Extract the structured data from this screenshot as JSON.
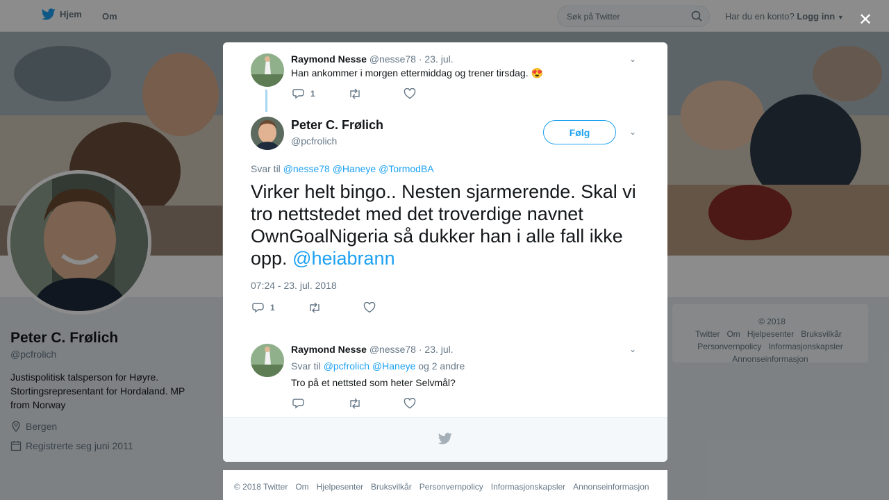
{
  "nav": {
    "home_label": "Hjem",
    "about_label": "Om",
    "search_placeholder": "Søk på Twitter",
    "account_question": "Har du en konto?",
    "login_label": "Logg inn"
  },
  "profile": {
    "name": "Peter C. Frølich",
    "handle": "@pcfrolich",
    "bio": "Justispolitisk talsperson for Høyre. Stortingsrepresentant for Hordaland. MP from Norway",
    "location": "Bergen",
    "joined": "Registrerte seg juni 2011"
  },
  "right_footer": [
    "© 2018 Twitter",
    "Om",
    "Hjelpesenter",
    "Bruksvilkår",
    "Personvernpolicy",
    "Informasjonskapsler",
    "Annonseinformasjon"
  ],
  "modal": {
    "parent_tweet": {
      "name": "Raymond Nesse",
      "handle": "@nesse78",
      "date": "· 23. jul.",
      "text": "Han ankommer i morgen ettermiddag og trener tirsdag. 😍",
      "reply_count": "1"
    },
    "main_tweet": {
      "name": "Peter C. Frølich",
      "handle": "@pcfrolich",
      "follow_label": "Følg",
      "reply_prefix": "Svar til",
      "reply_mentions": "@nesse78 @Haneye @TormodBA",
      "text": "Virker helt bingo.. Nesten sjarmerende. Skal vi tro nettstedet med det troverdige navnet OwnGoalNigeria så dukker han i alle fall ikke opp.",
      "text_mention": "@heiabrann",
      "timestamp": "07:24 - 23. jul. 2018",
      "reply_count": "1"
    },
    "reply_tweet": {
      "name": "Raymond Nesse",
      "handle": "@nesse78",
      "date": "· 23. jul.",
      "reply_prefix": "Svar til",
      "reply_mentions": "@pcfrolich @Haneye",
      "reply_suffix": "og 2 andre",
      "text": "Tro på et nettsted som heter Selvmål?"
    }
  },
  "bottom_footer": [
    "© 2018 Twitter",
    "Om",
    "Hjelpesenter",
    "Bruksvilkår",
    "Personvernpolicy",
    "Informasjonskapsler",
    "Annonseinformasjon"
  ],
  "colors": {
    "accent": "#1da1f2",
    "muted": "#657786",
    "thread_line": "#a7d5f2"
  }
}
